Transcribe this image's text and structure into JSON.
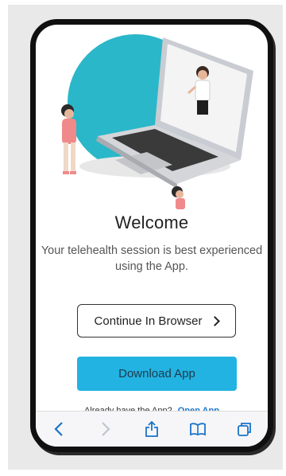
{
  "welcome": {
    "title": "Welcome",
    "subtitle_line1": "Your telehealth session is best experienced",
    "subtitle_line2": "using the App."
  },
  "buttons": {
    "continue_browser": "Continue In Browser",
    "download_app": "Download App"
  },
  "footer": {
    "already_text": "Already have the App?",
    "open_app": "Open App"
  },
  "toolbar": {
    "icons": [
      "back-icon",
      "forward-icon",
      "share-icon",
      "bookmarks-icon",
      "tabs-icon"
    ]
  },
  "colors": {
    "accent": "#22b3e2",
    "link": "#1a73c8",
    "illustration_circle": "#2ab7c9"
  }
}
